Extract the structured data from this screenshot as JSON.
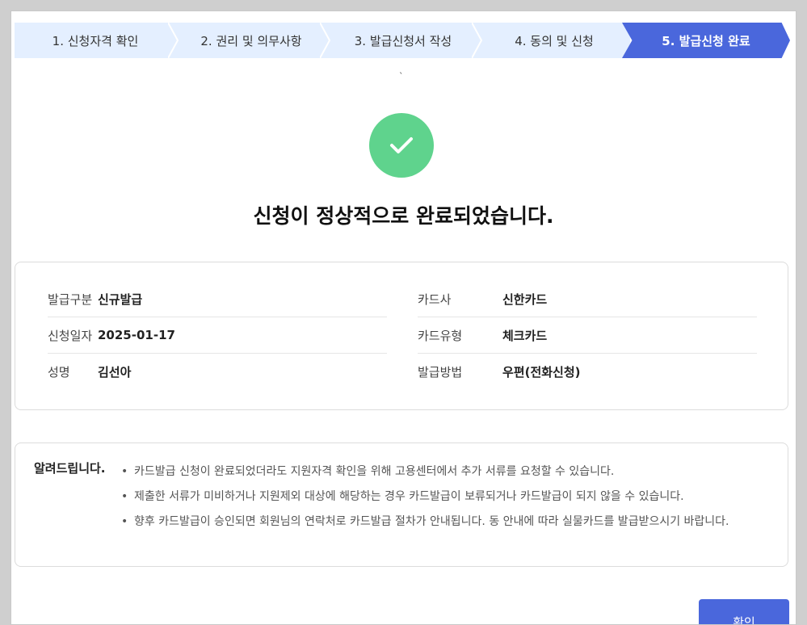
{
  "steps": [
    {
      "label": "1. 신청자격 확인",
      "active": false
    },
    {
      "label": "2. 권리 및 의무사항",
      "active": false
    },
    {
      "label": "3. 발급신청서 작성",
      "active": false
    },
    {
      "label": "4. 동의 및 신청",
      "active": false
    },
    {
      "label": "5. 발급신청 완료",
      "active": true
    }
  ],
  "stray_mark": "`",
  "status_icon": "check-icon",
  "headline": "신청이 정상적으로 완료되었습니다.",
  "info": {
    "left": [
      {
        "label": "발급구분",
        "value": "신규발급"
      },
      {
        "label": "신청일자",
        "value": "2025-01-17"
      },
      {
        "label": "성명",
        "value": "김선아"
      }
    ],
    "right": [
      {
        "label": "카드사",
        "value": "신한카드"
      },
      {
        "label": "카드유형",
        "value": "체크카드"
      },
      {
        "label": "발급방법",
        "value": "우편(전화신청)"
      }
    ]
  },
  "notice": {
    "title": "알려드립니다.",
    "items": [
      "카드발급 신청이 완료되었더라도 지원자격 확인을 위해 고용센터에서 추가 서류를 요청할 수 있습니다.",
      "제출한 서류가 미비하거나 지원제외 대상에 해당하는 경우 카드발급이 보류되거나 카드발급이 되지 않을 수 있습니다.",
      "향후 카드발급이 승인되면 회원님의 연락처로 카드발급 절차가 안내됩니다. 동 안내에 따라 실물카드를 발급받으시기 바랍니다."
    ]
  },
  "confirm_button": "확인",
  "colors": {
    "accent": "#4a67dc",
    "step_bg": "#e4efff",
    "success": "#5fd38d"
  }
}
